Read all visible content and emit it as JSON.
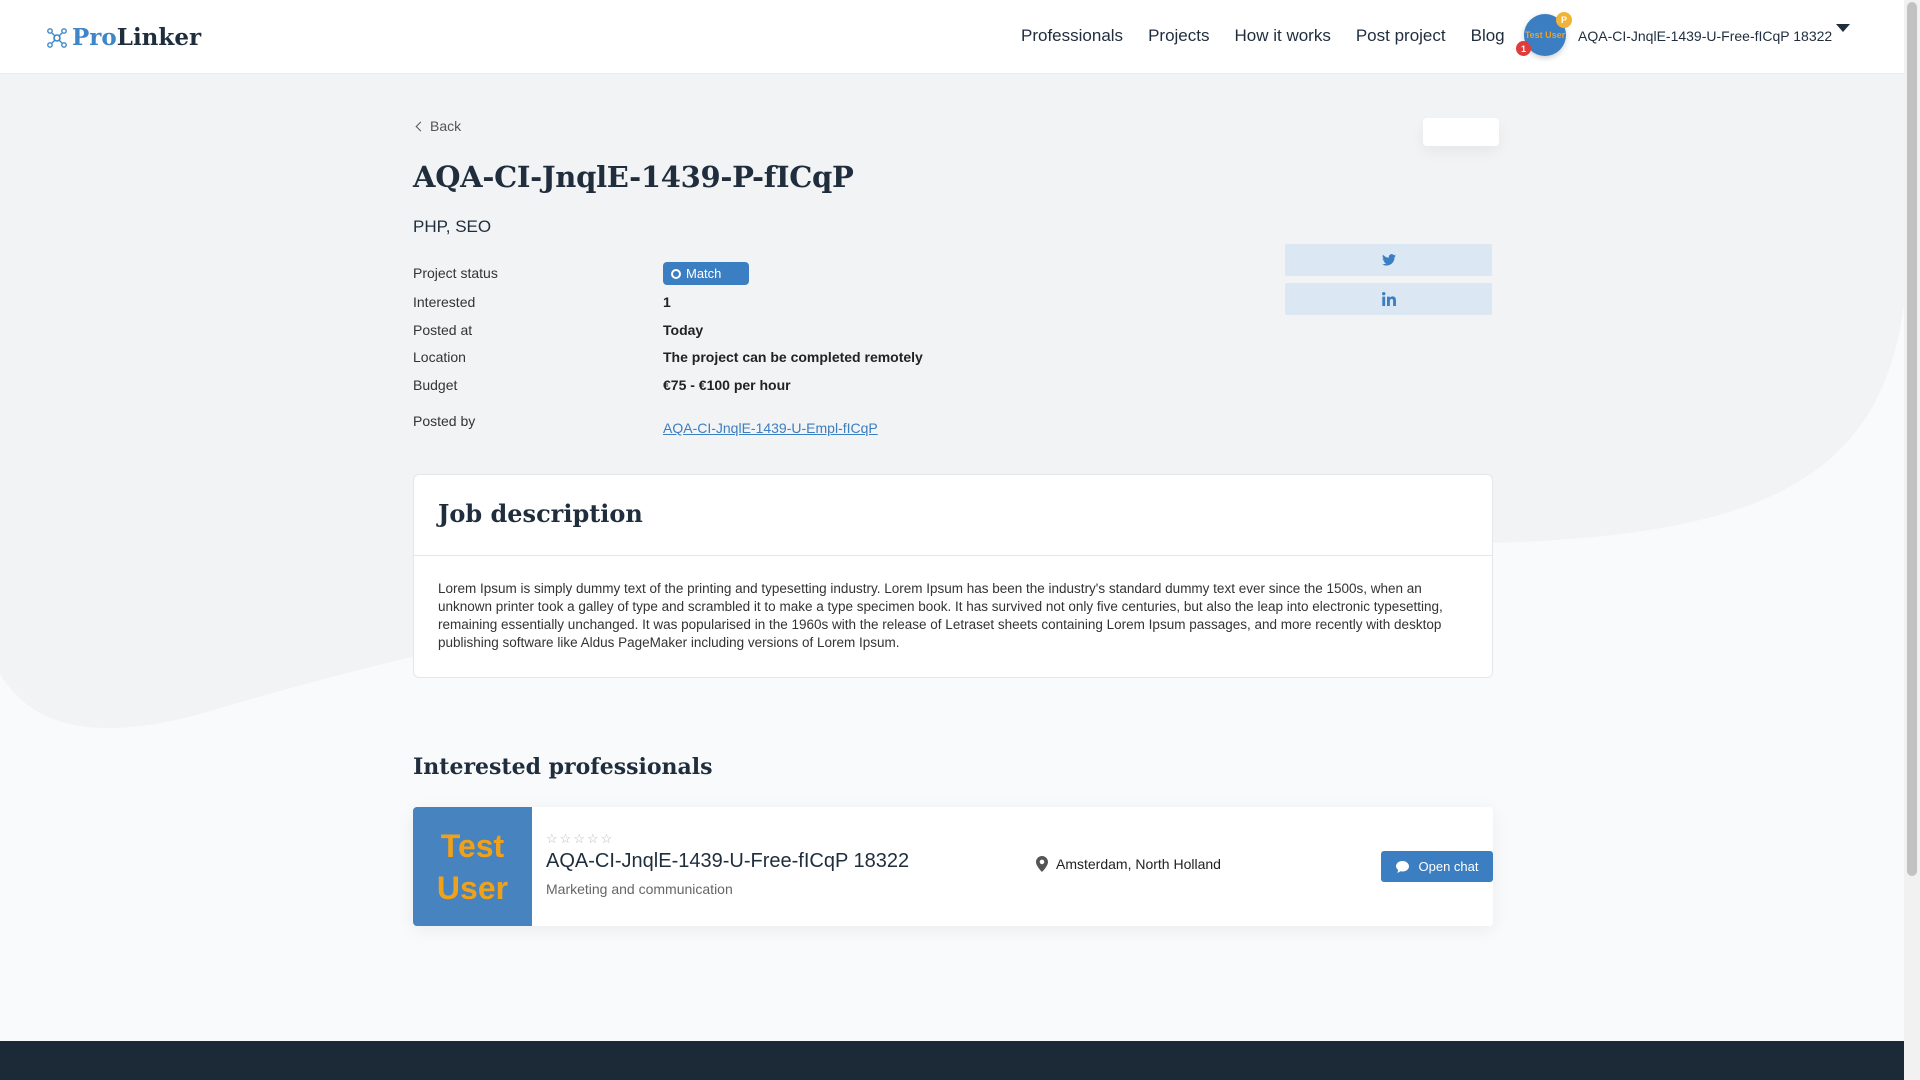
{
  "header": {
    "logo_pro": "Pro",
    "logo_linker": "Linker",
    "nav": [
      "Professionals",
      "Projects",
      "How it works",
      "Post project",
      "Blog"
    ],
    "user": {
      "avatar_text": "Test User",
      "points_badge": "P",
      "notification_count": "1",
      "name": "AQA-CI-JnqlE-1439-U-Free-fICqP 18322"
    }
  },
  "back_label": "Back",
  "project": {
    "title": "AQA-CI-JnqlE-1439-P-fICqP",
    "skills": "PHP, SEO",
    "details": {
      "status_label": "Project status",
      "status_value": "Match",
      "interested_label": "Interested",
      "interested_value": "1",
      "posted_at_label": "Posted at",
      "posted_at_value": "Today",
      "location_label": "Location",
      "location_value": "The project can be completed remotely",
      "budget_label": "Budget",
      "budget_value": "€75 - €100 per hour",
      "posted_by_label": "Posted by",
      "posted_by_value": "AQA-CI-JnqlE-1439-U-Empl-fICqP"
    }
  },
  "share": {
    "twitter_icon": "twitter-icon",
    "linkedin_icon": "linkedin-icon",
    "color": "#dbe7f3"
  },
  "job_description": {
    "title": "Job description",
    "text": "Lorem Ipsum is simply dummy text of the printing and typesetting industry. Lorem Ipsum has been the industry's standard dummy text ever since the 1500s, when an unknown printer took a galley of type and scrambled it to make a type specimen book. It has survived not only five centuries, but also the leap into electronic typesetting, remaining essentially unchanged. It was popularised in the 1960s with the release of Letraset sheets containing Lorem Ipsum passages, and more recently with desktop publishing software like Aldus PageMaker including versions of Lorem Ipsum."
  },
  "interested": {
    "title": "Interested professionals",
    "professional": {
      "image_text_1": "Test",
      "image_text_2": "User",
      "rating": 0,
      "rating_max": 5,
      "name": "AQA-CI-JnqlE-1439-U-Free-fICqP 18322",
      "category": "Marketing and communication",
      "location": "Amsterdam, North Holland",
      "chat_label": "Open chat"
    }
  },
  "colors": {
    "accent": "#3b7ec1",
    "text_dark": "#1f2d3d",
    "footer": "#1c2a38"
  }
}
